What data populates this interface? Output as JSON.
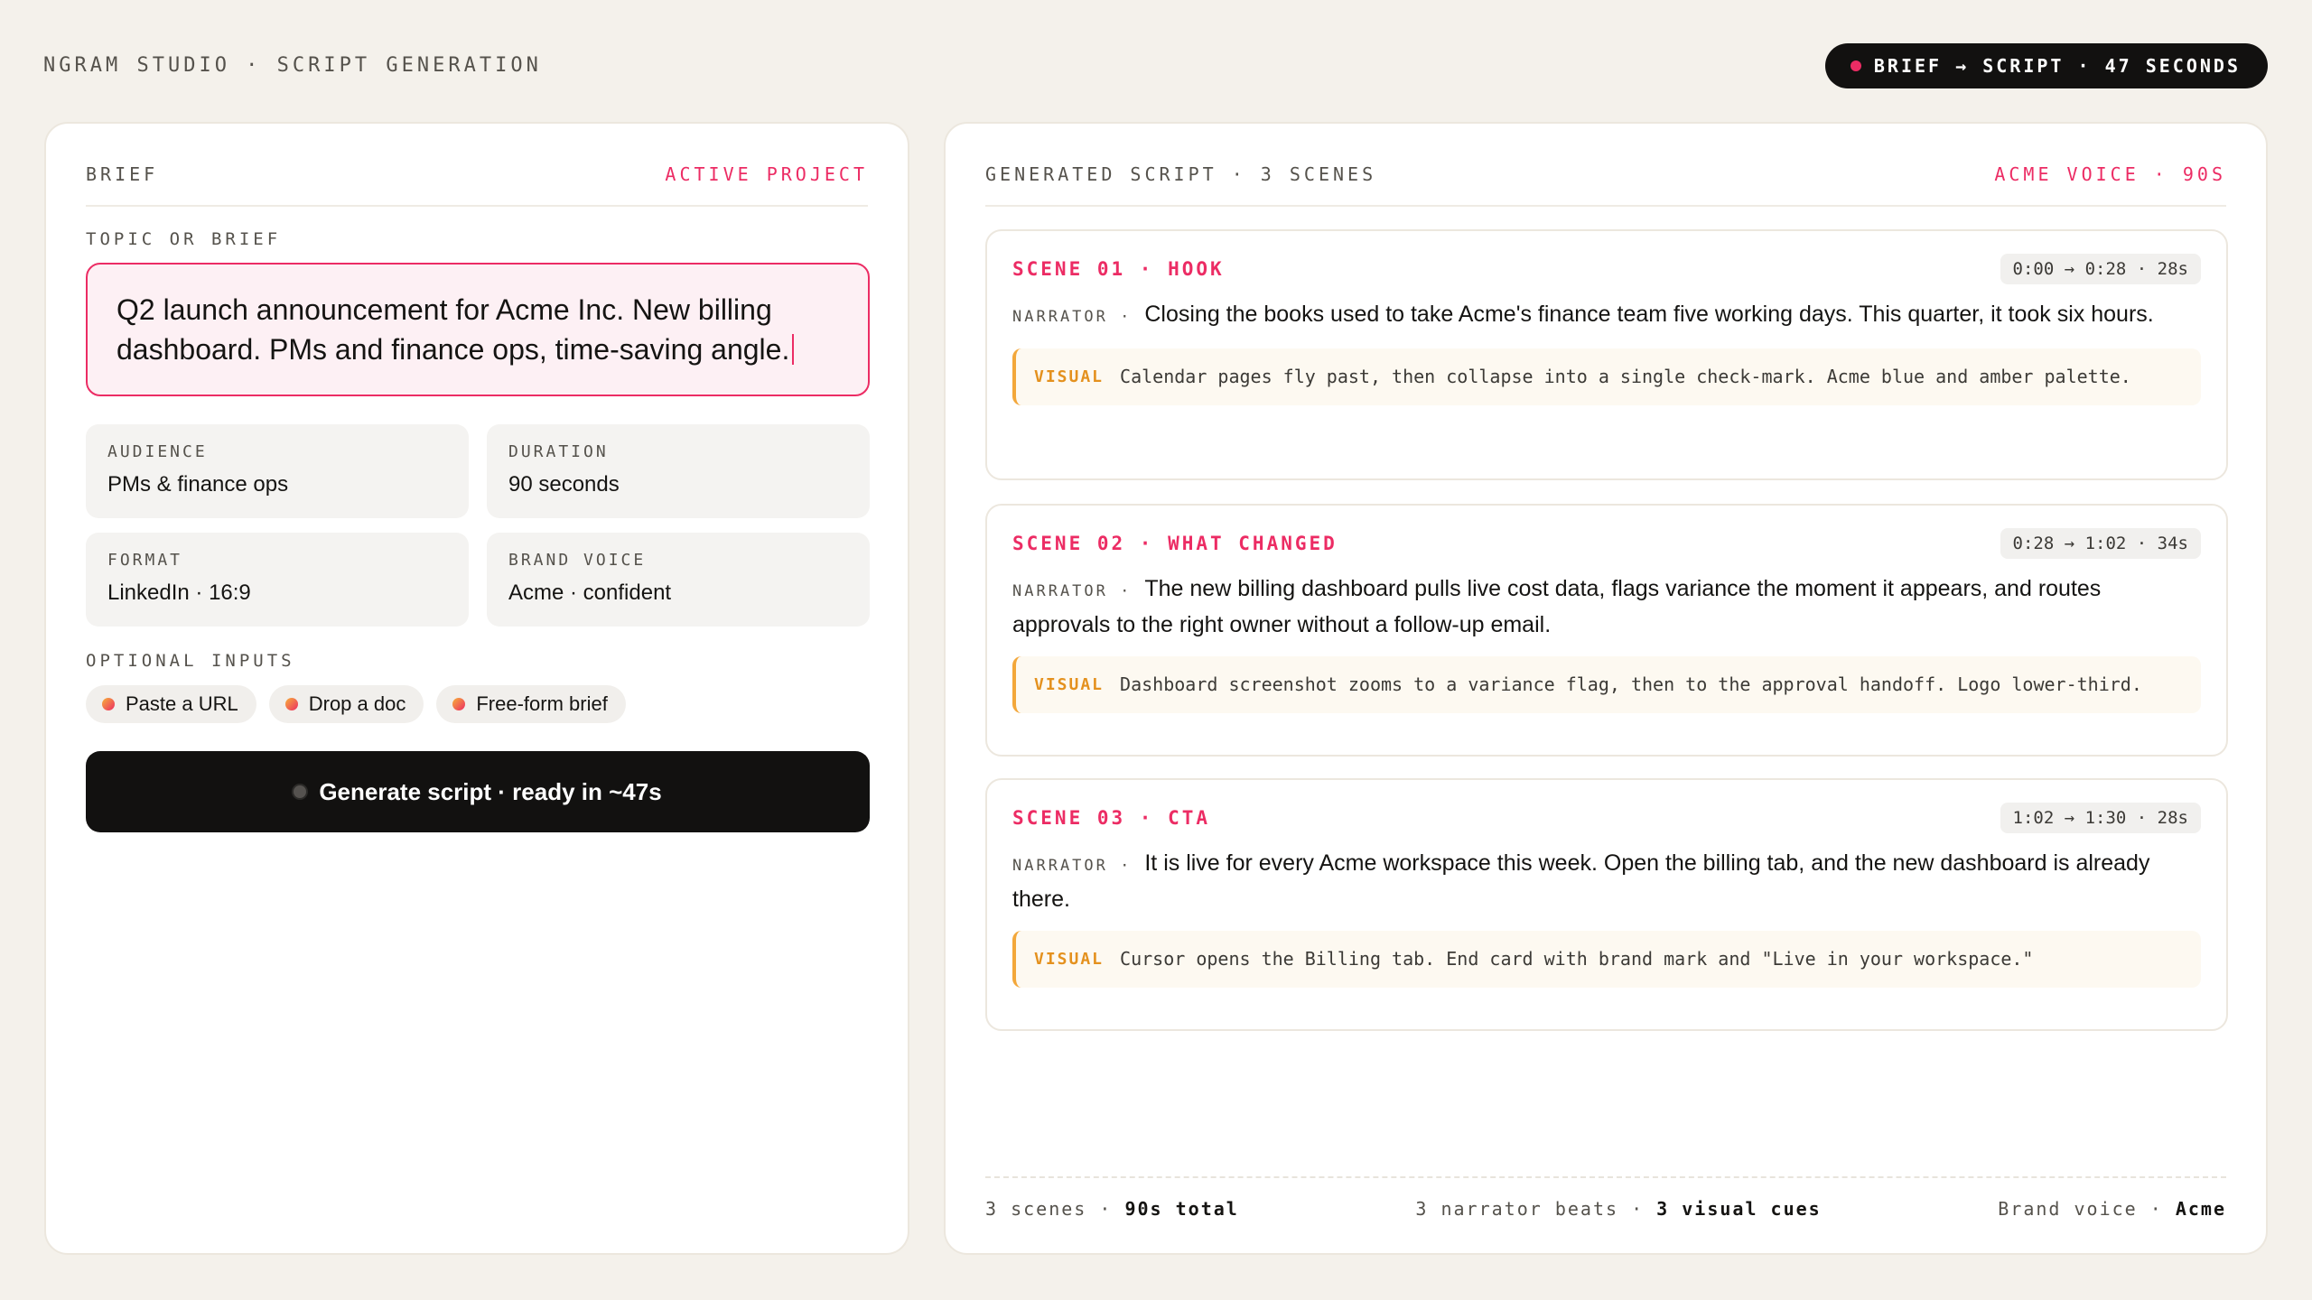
{
  "header": {
    "breadcrumb": "NGRAM STUDIO · SCRIPT GENERATION",
    "status": "BRIEF → SCRIPT · 47 SECONDS"
  },
  "brief": {
    "title": "BRIEF",
    "badge": "ACTIVE PROJECT",
    "topic_label": "TOPIC OR BRIEF",
    "topic_value": "Q2 launch announcement for Acme Inc. New billing dashboard. PMs and finance ops, time-saving angle.",
    "fields": {
      "audience": {
        "label": "AUDIENCE",
        "value": "PMs & finance ops"
      },
      "duration": {
        "label": "DURATION",
        "value": "90 seconds"
      },
      "format": {
        "label": "FORMAT",
        "value": "LinkedIn · 16:9"
      },
      "brand_voice": {
        "label": "BRAND VOICE",
        "value": "Acme · confident"
      }
    },
    "optional_label": "OPTIONAL INPUTS",
    "chips": [
      "Paste a URL",
      "Drop a doc",
      "Free-form brief"
    ],
    "generate_label": "Generate script · ready in ~47s"
  },
  "script": {
    "title": "GENERATED SCRIPT · 3 SCENES",
    "badge": "ACME VOICE · 90S",
    "narrator_tag": "NARRATOR ·",
    "visual_tag": "VISUAL",
    "scenes": [
      {
        "title": "SCENE 01 · HOOK",
        "time": "0:00 → 0:28 · 28s",
        "narration": "Closing the books used to take Acme's finance team five working days. This quarter, it took six hours.",
        "visual": "Calendar pages fly past, then collapse into a single check-mark. Acme blue and amber palette."
      },
      {
        "title": "SCENE 02 · WHAT CHANGED",
        "time": "0:28 → 1:02 · 34s",
        "narration": "The new billing dashboard pulls live cost data, flags variance the moment it appears, and routes approvals to the right owner without a follow-up email.",
        "visual": "Dashboard screenshot zooms to a variance flag, then to the approval handoff. Logo lower-third."
      },
      {
        "title": "SCENE 03 · CTA",
        "time": "1:02 → 1:30 · 28s",
        "narration": "It is live for every Acme workspace this week. Open the billing tab, and the new dashboard is already there.",
        "visual": "Cursor opens the Billing tab. End card with brand mark and \"Live in your workspace.\""
      }
    ],
    "footer": {
      "scenes_count": "3 scenes",
      "total": "90s total",
      "beats": "3 narrator beats",
      "cues": "3 visual cues",
      "voice_label": "Brand voice",
      "voice_value": "Acme"
    }
  },
  "colors": {
    "accent": "#ec2c64",
    "amber": "#f3a73a",
    "background": "#f4f1eb",
    "dark": "#121110"
  }
}
